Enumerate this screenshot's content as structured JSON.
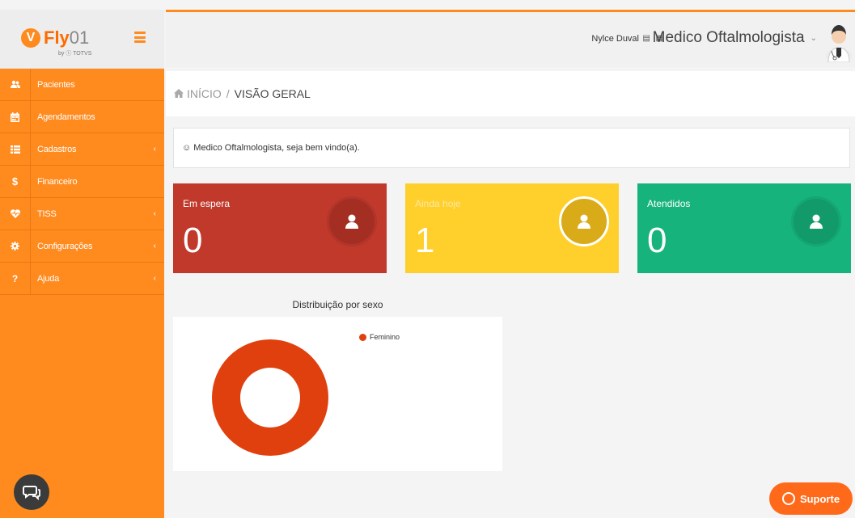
{
  "brand": {
    "name": "Fly",
    "suffix": "01",
    "sub": "by ⓣ TOTVS",
    "color": "#ff8a1e"
  },
  "sidebar": {
    "items": [
      {
        "label": "Pacientes",
        "icon": "users-icon"
      },
      {
        "label": "Agendamentos",
        "icon": "calendar-icon"
      },
      {
        "label": "Cadastros",
        "icon": "list-icon",
        "chevron": "‹"
      },
      {
        "label": "Financeiro",
        "icon": "dollar-icon"
      },
      {
        "label": "TISS",
        "icon": "heartbeat-icon",
        "chevron": "‹"
      },
      {
        "label": "Configurações",
        "icon": "gear-icon",
        "chevron": "‹"
      },
      {
        "label": "Ajuda",
        "icon": "question-icon",
        "chevron": "‹"
      }
    ]
  },
  "header": {
    "user_name": "Nylce Duval",
    "role": "Medico Oftalmologista"
  },
  "breadcrumb": {
    "home": "INÍCIO",
    "sep": "/",
    "current": "VISÃO GERAL"
  },
  "welcome": {
    "text": "☺ Medico Oftalmologista, seja bem vindo(a)."
  },
  "cards": [
    {
      "title": "Em espera",
      "value": "0",
      "color": "#c0392b"
    },
    {
      "title": "Ainda hoje",
      "value": "1",
      "color": "#ffcf2b"
    },
    {
      "title": "Atendidos",
      "value": "0",
      "color": "#16b37c"
    }
  ],
  "chart_data": {
    "type": "pie",
    "title": "Distribuição por sexo",
    "series": [
      {
        "name": "Feminino",
        "values": [
          1
        ]
      }
    ],
    "categories": [
      "Feminino"
    ],
    "colors": [
      "#e0400e"
    ],
    "donut": true,
    "legend": "top-right"
  },
  "support": {
    "label": "Suporte"
  }
}
